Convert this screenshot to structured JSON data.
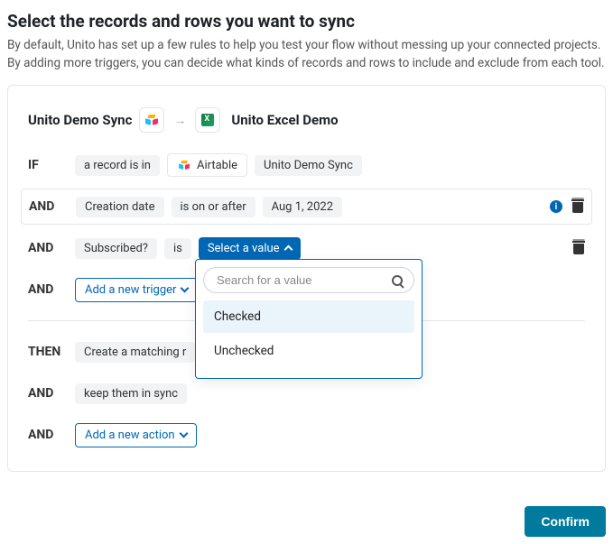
{
  "heading": "Select the records and rows you want to sync",
  "subtitle": "By default, Unito has set up a few rules to help you test your flow without messing up your connected projects. By adding more triggers, you can decide what kinds of records and rows to include and exclude from each tool.",
  "flow": {
    "source_name": "Unito Demo Sync",
    "dest_name": "Unito Excel Demo"
  },
  "triggers": {
    "row_if": {
      "op": "IF",
      "record_text": "a record is in",
      "tool": "Airtable",
      "container": "Unito Demo Sync"
    },
    "row_and_1": {
      "op": "AND",
      "field": "Creation date",
      "comparator": "is on or after",
      "value": "Aug 1, 2022"
    },
    "row_and_2": {
      "op": "AND",
      "field": "Subscribed?",
      "comparator": "is",
      "value_btn": "Select a value"
    },
    "row_and_3": {
      "op": "AND",
      "add_btn": "Add a new trigger"
    }
  },
  "dropdown": {
    "search_placeholder": "Search for a value",
    "options": [
      "Checked",
      "Unchecked"
    ]
  },
  "actions": {
    "row_then": {
      "op": "THEN",
      "text": "Create a matching r"
    },
    "row_and_1": {
      "op": "AND",
      "text": "keep them in sync"
    },
    "row_and_2": {
      "op": "AND",
      "add_btn": "Add a new action"
    }
  },
  "confirm": "Confirm"
}
